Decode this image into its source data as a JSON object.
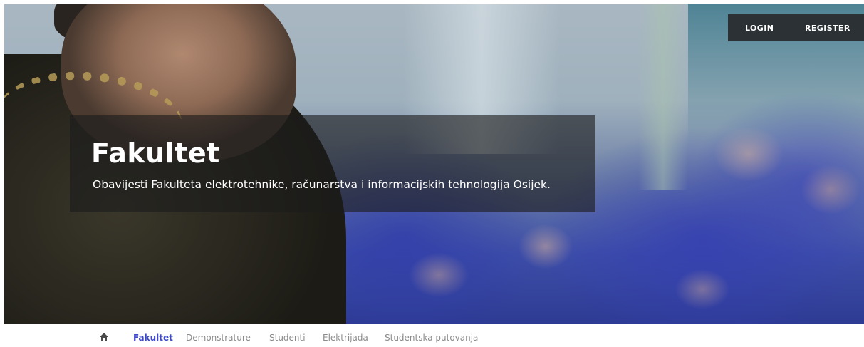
{
  "auth": {
    "login_label": "LOGIN",
    "register_label": "REGISTER"
  },
  "hero": {
    "title": "Fakultet",
    "subtitle": "Obavijesti Fakulteta elektrotehnike, računarstva i informacijskih tehnologija Osijek."
  },
  "nav": {
    "home_icon": "home-icon",
    "items": [
      {
        "label": "Fakultet",
        "active": true
      },
      {
        "label": "Demonstrature",
        "active": false
      },
      {
        "label": "Studenti",
        "active": false
      },
      {
        "label": "Elektrijada",
        "active": false
      },
      {
        "label": "Studentska putovanja",
        "active": false
      }
    ]
  },
  "colors": {
    "auth_bar_bg": "#2b3135",
    "nav_active": "#3e49c9",
    "nav_inactive": "#8a8a8a",
    "caption_overlay": "rgba(28,28,28,0.62)"
  }
}
